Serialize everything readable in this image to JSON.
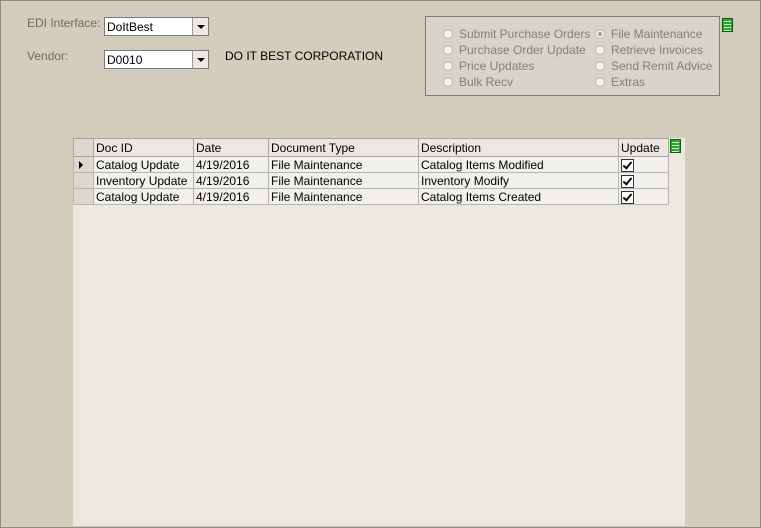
{
  "header": {
    "edi_label": "EDI Interface:",
    "edi_value": "DoItBest",
    "vendor_label": "Vendor:",
    "vendor_value": "D0010",
    "vendor_name": "DO IT BEST CORPORATION"
  },
  "radio_options": [
    {
      "label": "Submit Purchase Orders",
      "selected": false
    },
    {
      "label": "Purchase Order Update",
      "selected": false
    },
    {
      "label": "Price Updates",
      "selected": false
    },
    {
      "label": "Bulk Recv",
      "selected": false
    },
    {
      "label": "File Maintenance",
      "selected": true
    },
    {
      "label": "Retrieve Invoices",
      "selected": false
    },
    {
      "label": "Send Remit Advice",
      "selected": false
    },
    {
      "label": "Extras",
      "selected": false
    }
  ],
  "grid": {
    "columns": [
      "Doc ID",
      "Date",
      "Document Type",
      "Description",
      "Update"
    ],
    "rows": [
      {
        "doc_id": "Catalog Update",
        "date": "4/19/2016",
        "doc_type": "File Maintenance",
        "description": "Catalog Items Modified",
        "update": true,
        "current": true
      },
      {
        "doc_id": "Inventory Update",
        "date": "4/19/2016",
        "doc_type": "File Maintenance",
        "description": "Inventory Modify",
        "update": true,
        "current": false
      },
      {
        "doc_id": "Catalog Update",
        "date": "4/19/2016",
        "doc_type": "File Maintenance",
        "description": "Catalog Items Created",
        "update": true,
        "current": false
      }
    ]
  },
  "icons": {
    "options_menu": "column-chooser-icon",
    "grid_menu": "column-chooser-icon"
  }
}
